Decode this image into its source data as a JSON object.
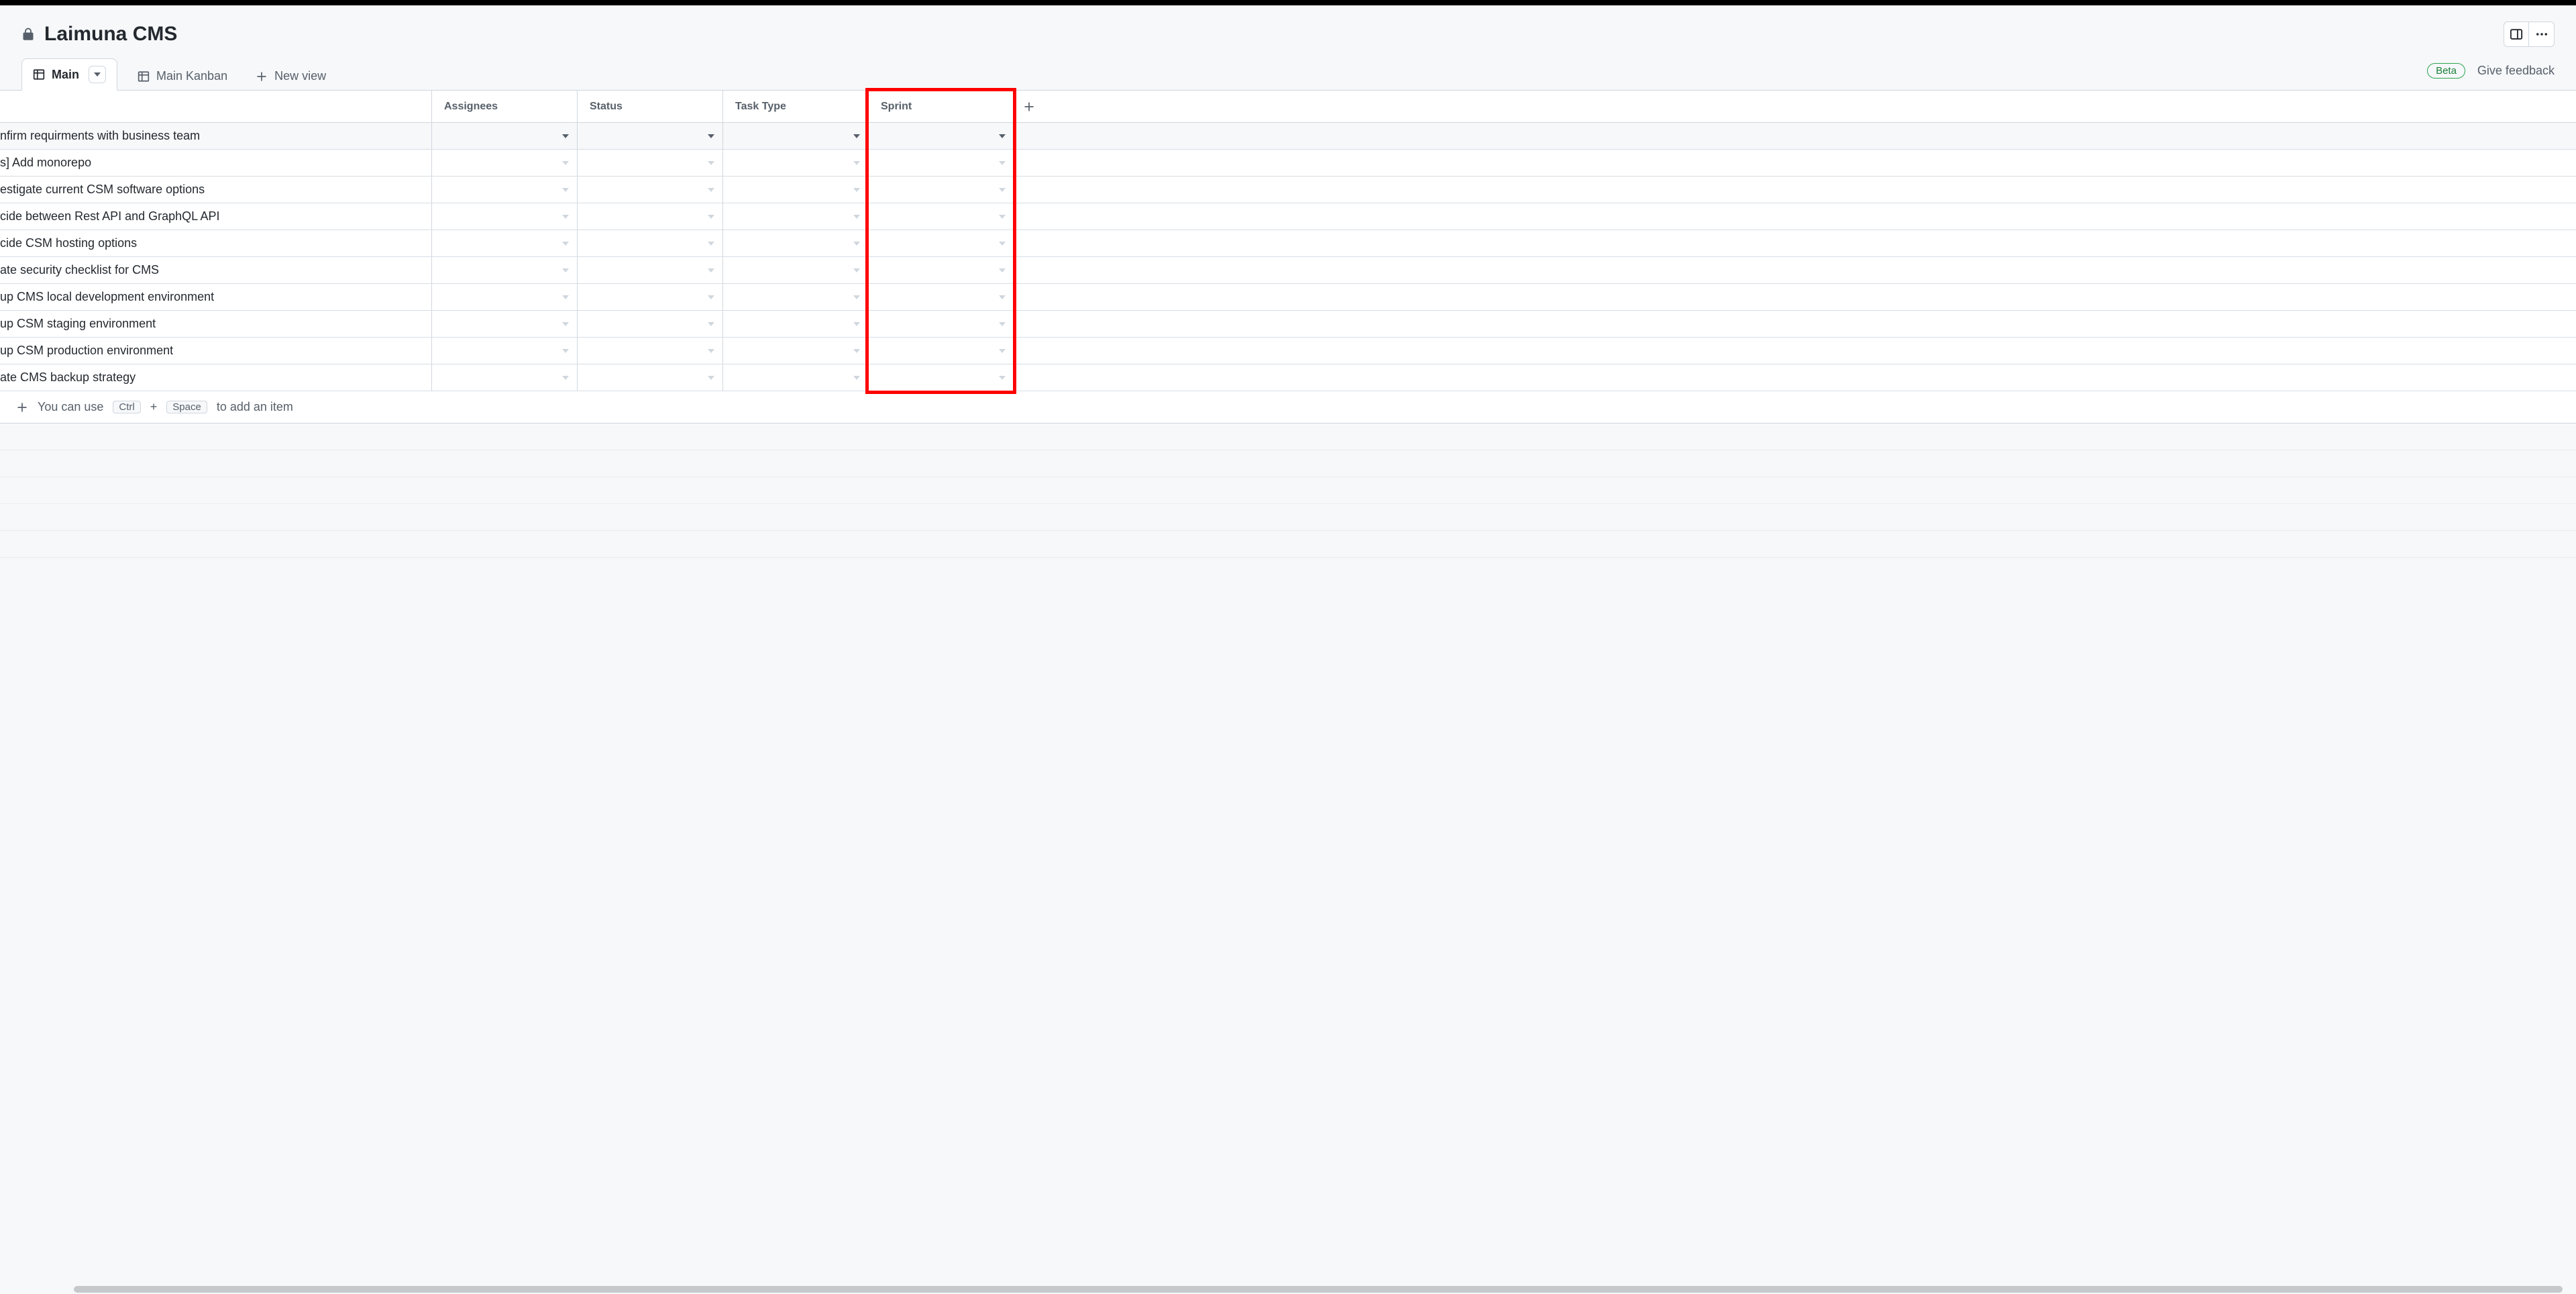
{
  "header": {
    "title": "Laimuna CMS"
  },
  "tabs": {
    "main": "Main",
    "kanban": "Main Kanban",
    "new_view": "New view"
  },
  "badges": {
    "beta": "Beta",
    "feedback": "Give feedback"
  },
  "columns": {
    "assignees": "Assignees",
    "status": "Status",
    "task_type": "Task Type",
    "sprint": "Sprint"
  },
  "rows": [
    {
      "title": "nfirm requirments with business team",
      "selected": true
    },
    {
      "title": "s] Add monorepo"
    },
    {
      "title": "estigate current CSM software options"
    },
    {
      "title": "cide between Rest API and GraphQL API"
    },
    {
      "title": "cide CSM hosting options"
    },
    {
      "title": "ate security checklist for CMS"
    },
    {
      "title": "up CMS local development environment"
    },
    {
      "title": "up CSM staging environment"
    },
    {
      "title": "up CSM production environment"
    },
    {
      "title": "ate CMS backup strategy"
    }
  ],
  "add_item_hint": {
    "prefix": "You can use",
    "key1": "Ctrl",
    "plus": "+",
    "key2": "Space",
    "suffix": "to add an item"
  }
}
